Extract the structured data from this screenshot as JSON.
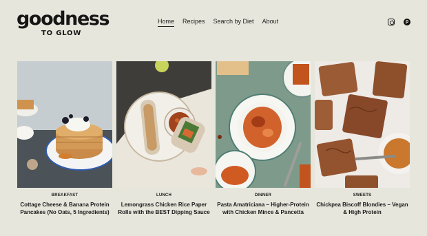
{
  "logo": {
    "main": "goodness",
    "sub": "TO GLOW"
  },
  "nav": [
    {
      "label": "Home",
      "active": true
    },
    {
      "label": "Recipes"
    },
    {
      "label": "Search by Diet"
    },
    {
      "label": "About"
    }
  ],
  "social": {
    "instagram": "instagram-icon",
    "pinterest": "pinterest-icon",
    "pinterest_glyph": "p"
  },
  "cards": [
    {
      "category": "BREAKFAST",
      "title": "Cottage Cheese & Banana Protein Pancakes (No Oats, 5 Ingredients)"
    },
    {
      "category": "LUNCH",
      "title": "Lemongrass Chicken Rice Paper Rolls with the BEST Dipping Sauce"
    },
    {
      "category": "DINNER",
      "title": "Pasta Amatriciana – Higher-Protein with Chicken Mince & Pancetta"
    },
    {
      "category": "SWEETS",
      "title": "Chickpea Biscoff Blondies – Vegan & High Protein"
    }
  ]
}
